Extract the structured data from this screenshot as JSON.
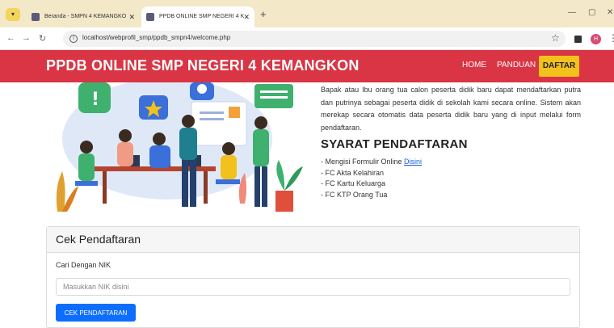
{
  "browser": {
    "tabs": [
      {
        "label": "Beranda - SMPN 4 KEMANGKO"
      },
      {
        "label": "PPDB ONLINE SMP NEGERI 4 K"
      }
    ],
    "url": "localhost/webprofil_smp/ppdb_smpn4/welcome.php",
    "profile_initial": "H"
  },
  "navbar": {
    "brand": "PPDB ONLINE SMP NEGERI 4 KEMANGKON",
    "links": [
      "HOME",
      "PANDUAN"
    ],
    "cta": "DAFTAR",
    "color": "#d93545",
    "cta_color": "#f3c11b"
  },
  "hero": {
    "intro": "Bapak atau Ibu orang tua calon peserta didik baru dapat mendaftarkan putra dan putrinya sebagai peserta didik di sekolah kami secara online. Sistem akan merekap secara otomatis data peserta didik baru yang di input melalui form pendaftaran.",
    "syarat_title": "SYARAT PENDAFTARAN",
    "syarat_first_prefix": "- Mengisi Formulir Online ",
    "syarat_first_link": "Disini",
    "syarat_items": [
      "- FC Akta Kelahiran",
      "- FC Kartu Keluarga",
      "- FC KTP Orang Tua"
    ]
  },
  "cek": {
    "title": "Cek Pendaftaran",
    "label": "Cari Dengan NIK",
    "placeholder": "Masukkan NIK disini",
    "button": "CEK PENDAFTARAN",
    "button_color": "#0d6efd"
  }
}
